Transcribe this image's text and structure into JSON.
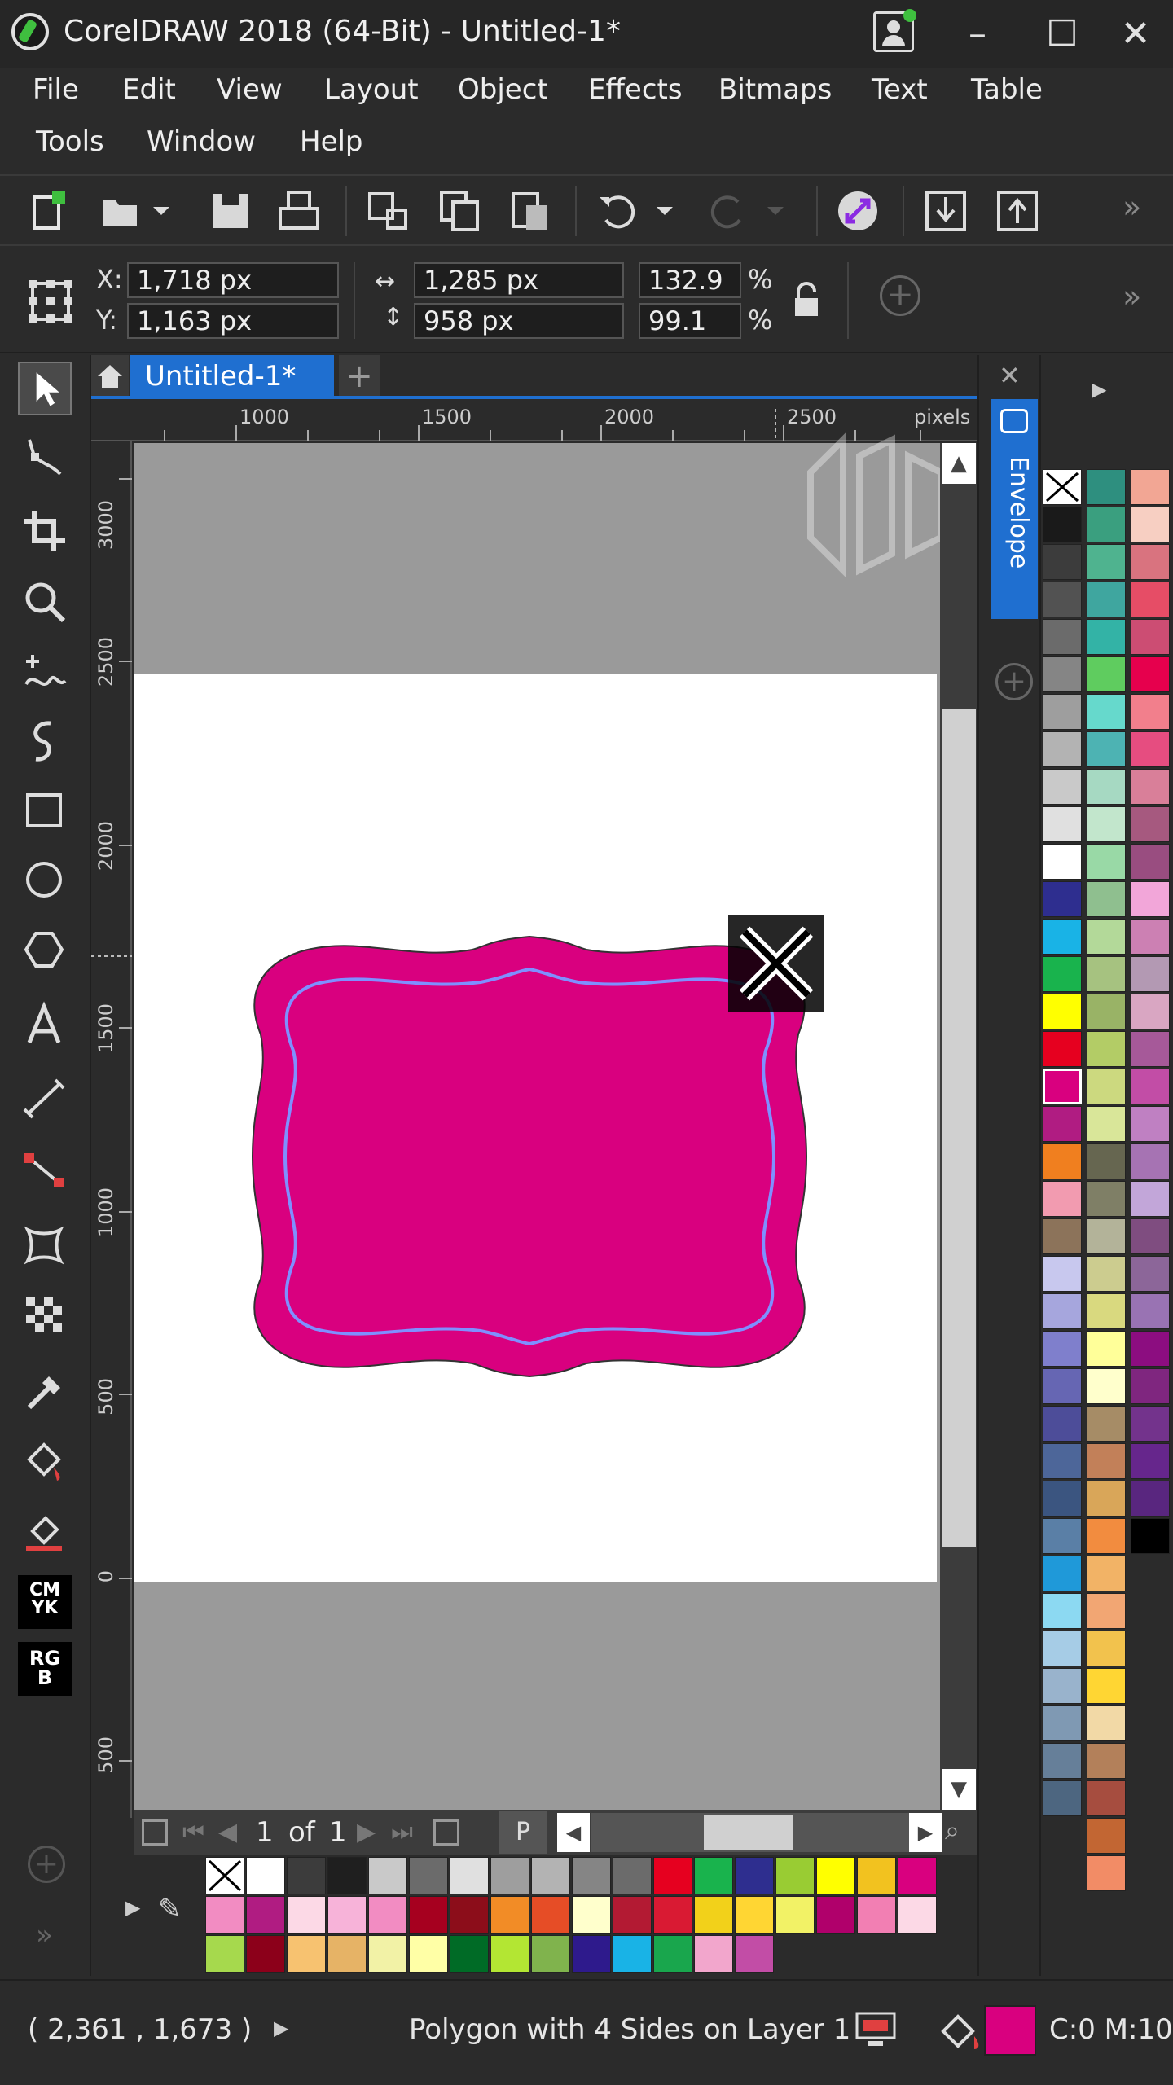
{
  "window": {
    "title": "CorelDRAW 2018 (64-Bit) - Untitled-1*"
  },
  "menu": {
    "file": "File",
    "edit": "Edit",
    "view": "View",
    "layout": "Layout",
    "object": "Object",
    "effects": "Effects",
    "bitmaps": "Bitmaps",
    "text": "Text",
    "table": "Table",
    "tools": "Tools",
    "window": "Window",
    "help": "Help"
  },
  "properties": {
    "x_label": "X:",
    "x_value": "1,718 px",
    "y_label": "Y:",
    "y_value": "1,163 px",
    "w_value": "1,285 px",
    "h_value": "958 px",
    "scale_w": "132.9",
    "scale_h": "99.1",
    "pct": "%"
  },
  "tabs": {
    "document": "Untitled-1*",
    "add": "+"
  },
  "ruler": {
    "h_ticks": [
      "1000",
      "1500",
      "2000",
      "2500"
    ],
    "h_units": "pixels",
    "v_ticks": [
      "3000",
      "2500",
      "2000",
      "1500",
      "1000",
      "500",
      "0",
      "500"
    ]
  },
  "docker": {
    "envelope_label": "Envelope"
  },
  "pagenav": {
    "current": "1",
    "of": "of",
    "total": "1",
    "page_tab": "P"
  },
  "status": {
    "coords": "( 2,361 , 1,673  )",
    "object_info": "Polygon with 4 Sides on Layer 1",
    "fill_info": "C:0 M:10"
  },
  "colors": {
    "accent": "#1f6fd0",
    "shape_fill": "#d9007f",
    "inner_outline": "#7f8fff"
  },
  "icons": {
    "app": "coreldraw-icon",
    "minimize": "minimize-icon",
    "maximize": "maximize-icon",
    "close": "close-icon",
    "new": "new-document-icon",
    "open": "open-icon",
    "save": "save-icon",
    "print": "print-icon",
    "undo": "undo-icon",
    "redo": "redo-icon",
    "import": "import-icon",
    "export": "export-icon",
    "lock": "lock-icon",
    "home": "home-icon"
  }
}
